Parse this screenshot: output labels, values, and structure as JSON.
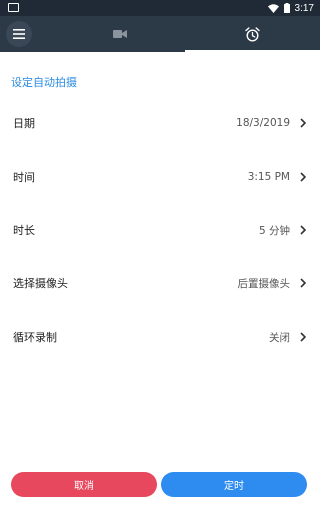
{
  "status_bar": {
    "time": "3:17"
  },
  "icons": {
    "menu": "hamburger-menu-icon",
    "video": "video-camera-icon",
    "alarm": "alarm-clock-icon",
    "chevron": "chevron-right-icon"
  },
  "section_title": "设定自动拍摄",
  "settings": [
    {
      "label": "日期",
      "value": "18/3/2019"
    },
    {
      "label": "时间",
      "value": "3:15 PM"
    },
    {
      "label": "时长",
      "value": "5 分钟"
    },
    {
      "label": "选择摄像头",
      "value": "后置摄像头"
    },
    {
      "label": "循环录制",
      "value": "关闭"
    }
  ],
  "buttons": {
    "cancel": "取消",
    "confirm": "定时"
  },
  "colors": {
    "toolbar": "#2c3947",
    "status_bar": "#1f2a36",
    "accent": "#2a8ae0",
    "cancel": "#e8485d",
    "confirm": "#2e8cf0"
  }
}
